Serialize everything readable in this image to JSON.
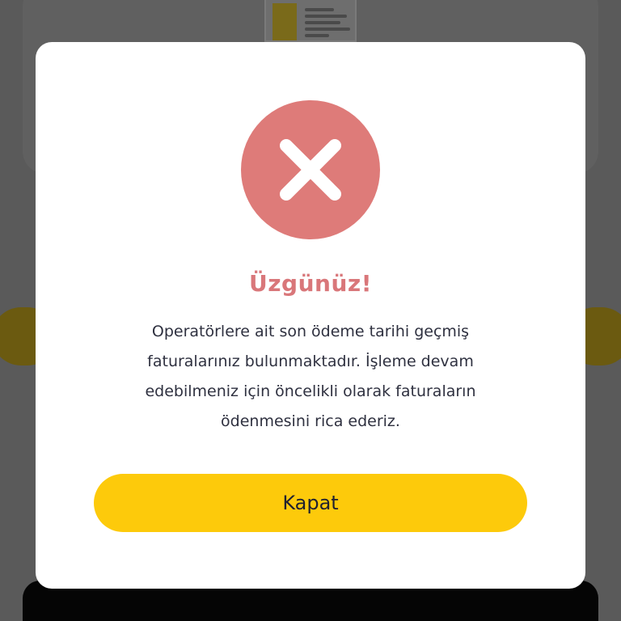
{
  "dialog": {
    "icon": "close-icon",
    "title": "Üzgünüz!",
    "message": "Operatörlere ait son ödeme tarihi geçmiş faturalarınız bulunmaktadır. İşleme devam edebilmeniz için öncelikli olarak faturaların ödenmesini rica ederiz.",
    "close_label": "Kapat"
  },
  "colors": {
    "accent": "#fdca0b",
    "error": "#de7b79",
    "title": "#d9777a",
    "text": "#2f3140"
  }
}
